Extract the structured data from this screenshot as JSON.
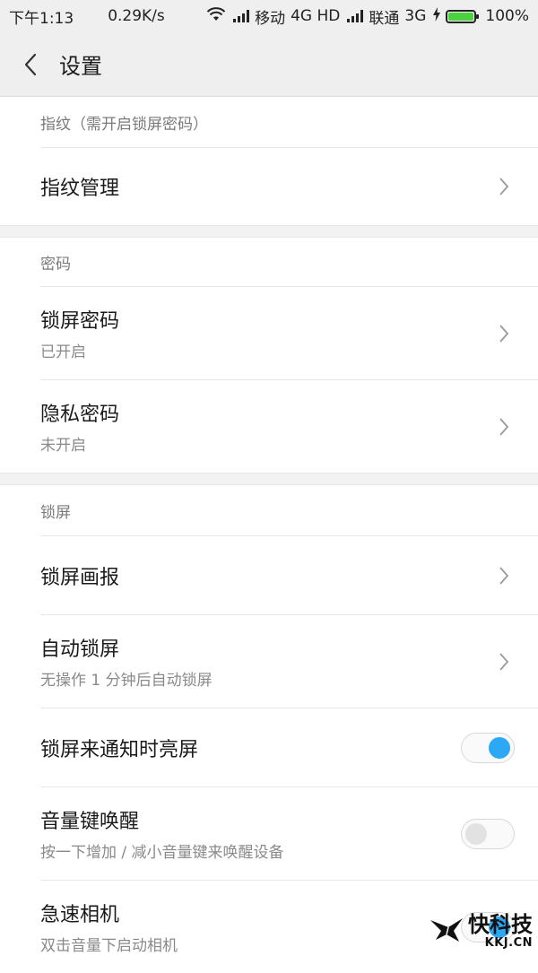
{
  "statusbar": {
    "time": "下午1:13",
    "speed": "0.29K/s",
    "carrier1": "移动",
    "network1": "4G HD",
    "carrier2": "联通",
    "network2": "3G",
    "battery": "100%"
  },
  "header": {
    "title": "设置"
  },
  "sections": {
    "fingerprint": {
      "header": "指纹（需开启锁屏密码）",
      "items": [
        {
          "title": "指纹管理"
        }
      ]
    },
    "password": {
      "header": "密码",
      "items": [
        {
          "title": "锁屏密码",
          "subtitle": "已开启"
        },
        {
          "title": "隐私密码",
          "subtitle": "未开启"
        }
      ]
    },
    "lockscreen": {
      "header": "锁屏",
      "items": [
        {
          "title": "锁屏画报"
        },
        {
          "title": "自动锁屏",
          "subtitle": "无操作 1 分钟后自动锁屏"
        },
        {
          "title": "锁屏来通知时亮屏",
          "toggle": true
        },
        {
          "title": "音量键唤醒",
          "subtitle": "按一下增加 / 减小音量键来唤醒设备",
          "toggle": false
        },
        {
          "title": "急速相机",
          "subtitle": "双击音量下启动相机",
          "toggle": true
        }
      ]
    }
  },
  "watermark": {
    "main": "快科技",
    "sub": "KKJ.CN"
  },
  "colors": {
    "accent": "#2da8f5",
    "battery": "#4cd23f"
  }
}
